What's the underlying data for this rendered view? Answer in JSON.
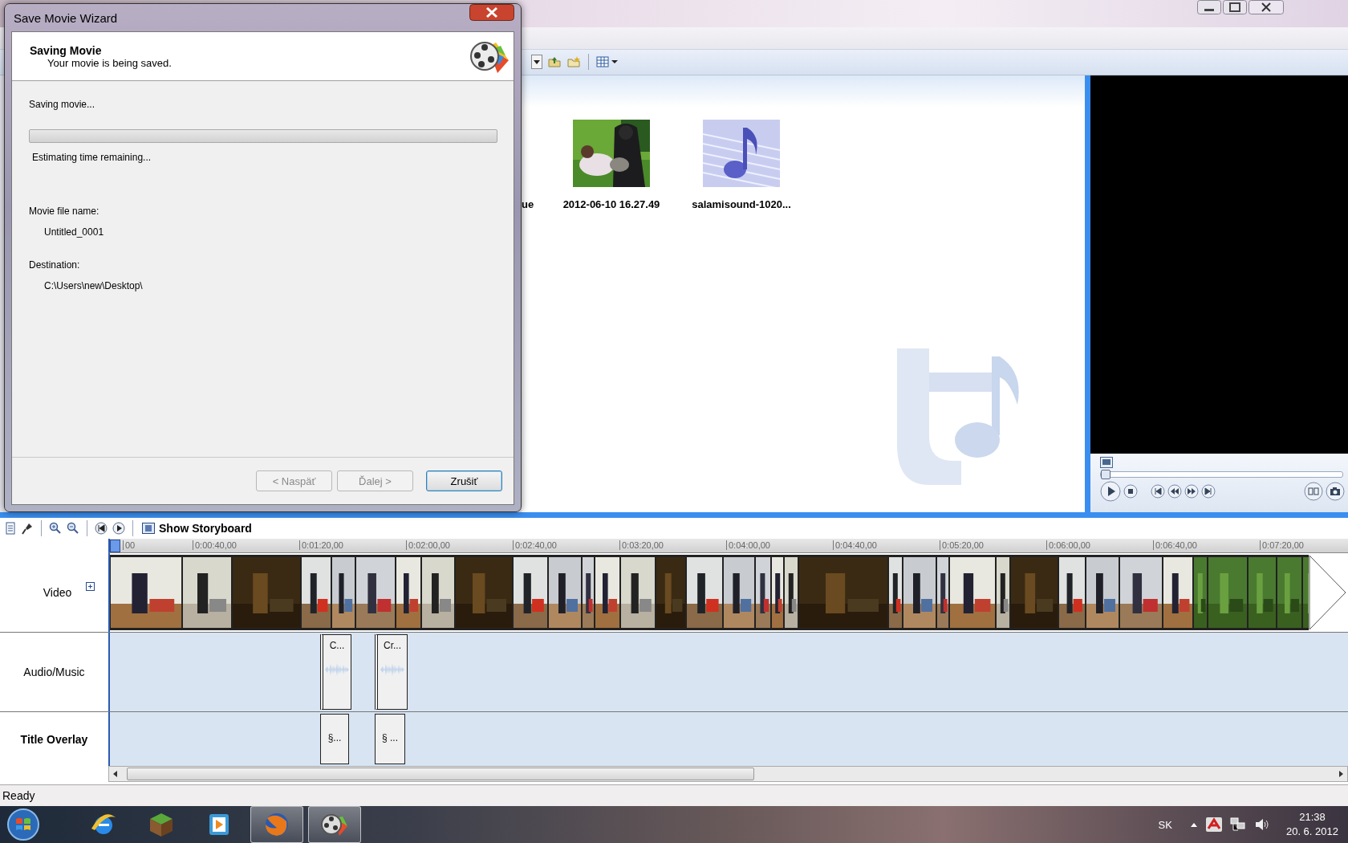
{
  "dialog": {
    "title": "Save Movie Wizard",
    "header": {
      "title": "Saving Movie",
      "subtitle": "Your movie is being saved."
    },
    "status": "Saving movie...",
    "progress": {
      "level": 0
    },
    "time_text": "Estimating time remaining...",
    "fields": [
      {
        "label": "Movie file name:",
        "value": "Untitled_0001"
      },
      {
        "label": "Destination:",
        "value": "C:\\Users\\new\\Desktop\\"
      }
    ],
    "buttons": [
      {
        "label": "< Naspäť",
        "disabled": true,
        "default": false
      },
      {
        "label": "Ďalej >",
        "disabled": true,
        "default": false
      },
      {
        "label": "Zrušiť",
        "disabled": false,
        "default": true
      }
    ]
  },
  "collection": {
    "items": [
      {
        "label": "ue",
        "kind": "partial"
      },
      {
        "label": "2012-06-10 16.27.49"
      },
      {
        "label": "salamisound-1020...",
        "kind": "audio"
      }
    ]
  },
  "preview": {
    "seek": {
      "level": 0
    }
  },
  "timeline": {
    "storyboard_button": "Show Storyboard",
    "ruler": [
      "00",
      "0:00:40,00",
      "0:01:20,00",
      "0:02:00,00",
      "0:02:40,00",
      "0:03:20,00",
      "0:04:00,00",
      "0:04:40,00",
      "0:05:20,00",
      "0:06:00,00",
      "0:06:40,00",
      "0:07:20,00"
    ],
    "tracks": [
      {
        "label": "Video",
        "kind": "video",
        "expanded": false
      },
      {
        "label": "Audio/Music",
        "kind": "audio",
        "clips": [
          "C...",
          "Cr..."
        ]
      },
      {
        "label": "Title Overlay",
        "kind": "title",
        "clips": [
          "§...",
          "§ ..."
        ]
      }
    ]
  },
  "status_bar": "Ready",
  "taskbar": {
    "apps": [
      {
        "kind": "browser-e",
        "selected": false
      },
      {
        "kind": "block",
        "selected": false
      },
      {
        "kind": "player",
        "selected": false
      },
      {
        "kind": "fox",
        "selected": true
      },
      {
        "kind": "film",
        "selected": true
      }
    ],
    "language": "SK",
    "time": "21:38",
    "date": "20. 6. 2012"
  }
}
